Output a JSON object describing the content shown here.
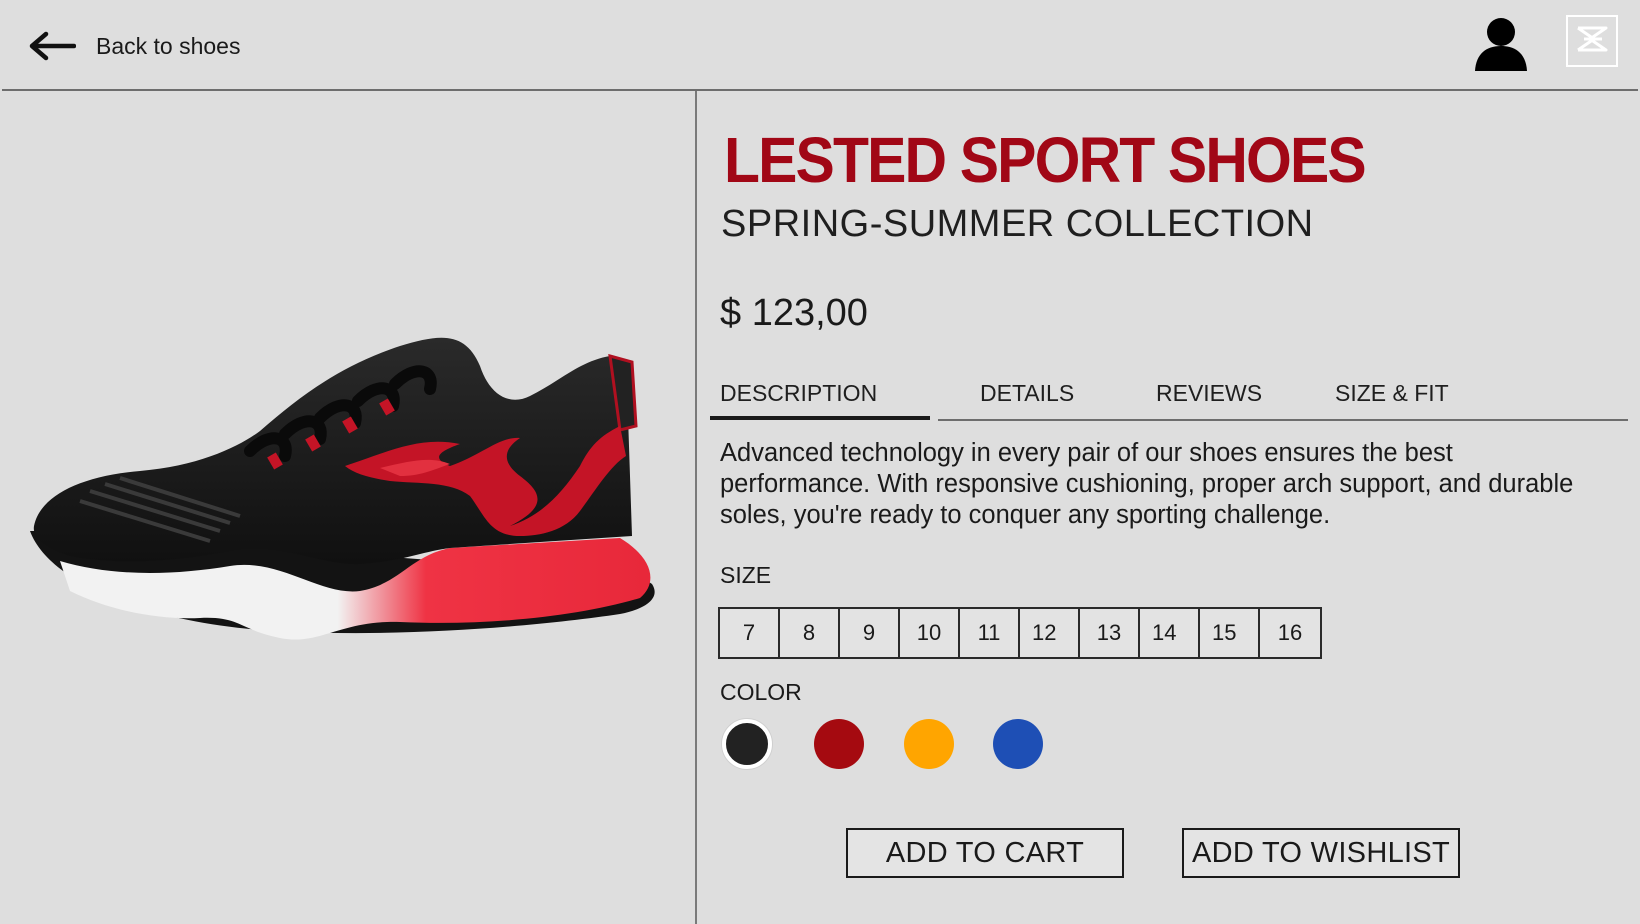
{
  "header": {
    "back_label": "Back to shoes",
    "back_icon": "arrow-left-icon",
    "user_icon": "user-icon",
    "menu_icon": "app-logo-icon"
  },
  "product": {
    "title": "LESTED SPORT SHOES",
    "subtitle": "SPRING-SUMMER COLLECTION",
    "price": "$ 123,00",
    "accent_color": "#a10716",
    "image_alt": "black sneaker with red flame design"
  },
  "tabs": [
    {
      "label": "DESCRIPTION",
      "active": true
    },
    {
      "label": "DETAILS",
      "active": false
    },
    {
      "label": "REVIEWS",
      "active": false
    },
    {
      "label": "SIZE & FIT",
      "active": false
    }
  ],
  "description": "Advanced technology in every pair of our shoes ensures the best performance. With responsive cushioning, proper arch support, and durable soles, you're ready to conquer any sporting challenge.",
  "size": {
    "label": "SIZE",
    "options": [
      "7",
      "8",
      "9",
      "10",
      "11",
      "12",
      "13",
      "14",
      "15",
      "16"
    ]
  },
  "color": {
    "label": "COLOR",
    "options": [
      {
        "name": "black",
        "hex": "#222222",
        "selected": true
      },
      {
        "name": "red",
        "hex": "#a50a10",
        "selected": false
      },
      {
        "name": "yellow",
        "hex": "#ffa500",
        "selected": false
      },
      {
        "name": "blue",
        "hex": "#1e4fb5",
        "selected": false
      }
    ]
  },
  "actions": {
    "add_to_cart": "ADD TO CART",
    "add_to_wishlist": "ADD TO WISHLIST"
  }
}
